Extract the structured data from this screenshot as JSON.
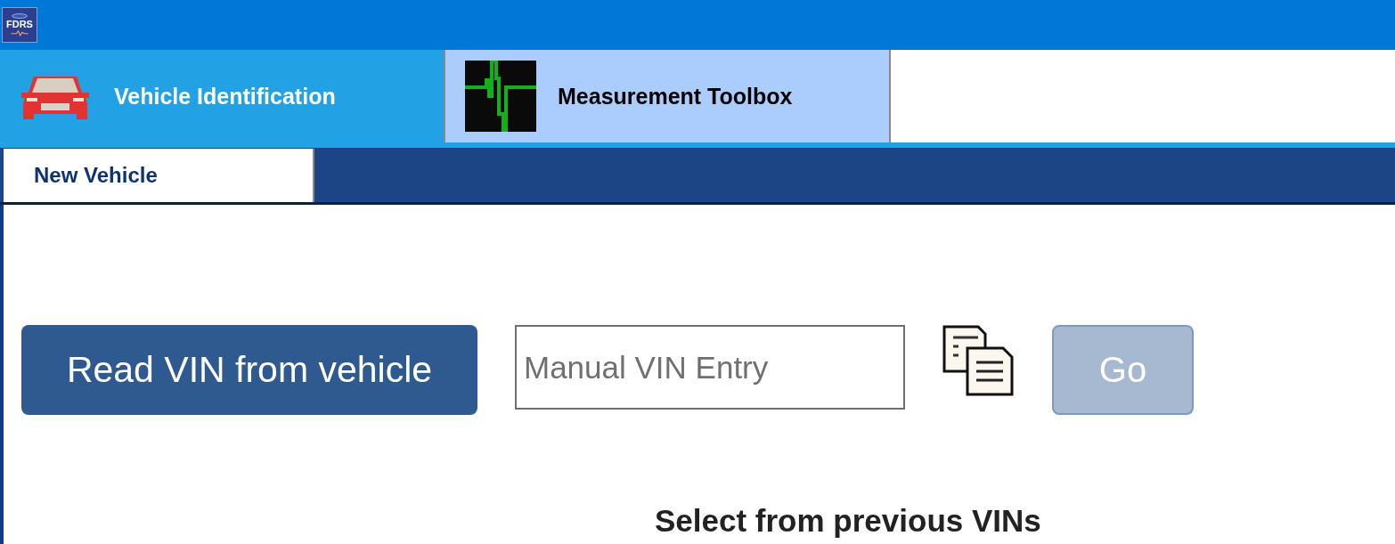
{
  "app_logo": {
    "text": "FDRS"
  },
  "tabs": [
    {
      "label": "Vehicle Identification",
      "kind": "car",
      "selected": true
    },
    {
      "label": "Measurement Toolbox",
      "kind": "waveform",
      "selected": false
    }
  ],
  "subtabs": [
    {
      "label": "New Vehicle",
      "selected": true
    }
  ],
  "read_button": {
    "label": "Read VIN from vehicle"
  },
  "vin_field": {
    "placeholder": "Manual VIN Entry"
  },
  "go_button": {
    "label": "Go",
    "disabled": true
  },
  "previous_heading": "Select from previous VINs"
}
